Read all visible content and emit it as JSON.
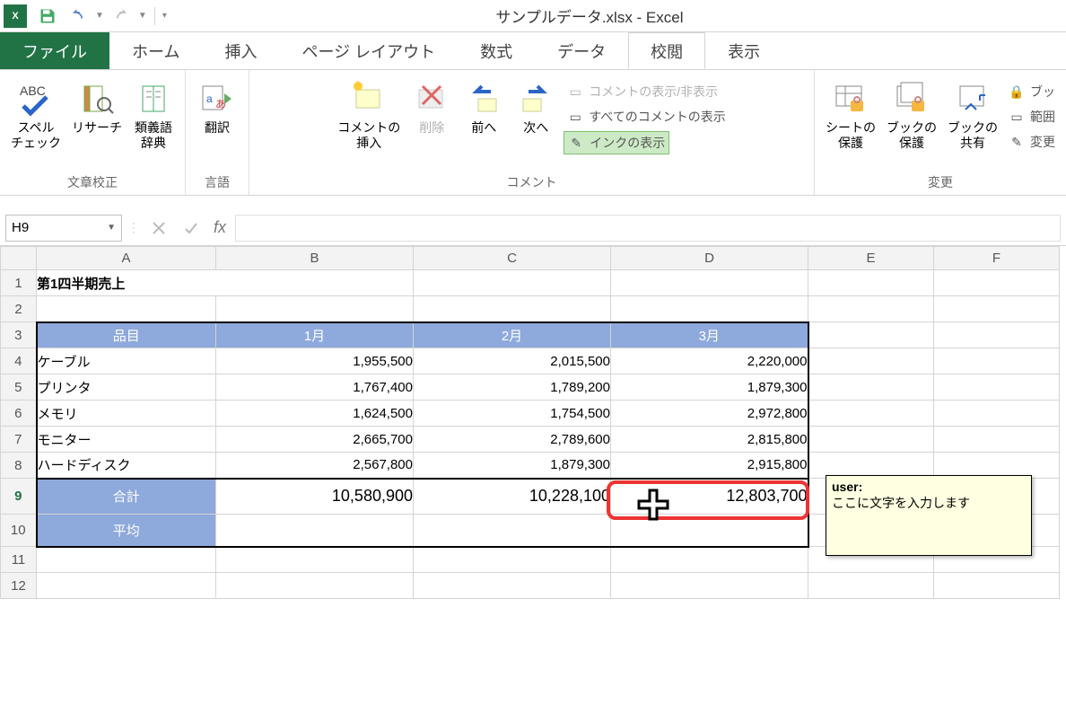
{
  "title": "サンプルデータ.xlsx - Excel",
  "qat": {
    "app_abbrev": "x",
    "save": "保存",
    "undo": "元に戻す",
    "redo": "やり直し"
  },
  "tabs": {
    "file": "ファイル",
    "home": "ホーム",
    "insert": "挿入",
    "pagelayout": "ページ レイアウト",
    "formulas": "数式",
    "data": "データ",
    "review": "校閲",
    "view": "表示"
  },
  "ribbon": {
    "proofing": {
      "label": "文章校正",
      "spell": "スペル\nチェック",
      "research": "リサーチ",
      "thesaurus": "類義語\n辞典"
    },
    "language": {
      "label": "言語",
      "translate": "翻訳"
    },
    "comments": {
      "label": "コメント",
      "new": "コメントの\n挿入",
      "delete": "削除",
      "prev": "前へ",
      "next": "次へ",
      "toggle": "コメントの表示/非表示",
      "showall": "すべてのコメントの表示",
      "ink": "インクの表示"
    },
    "changes": {
      "label": "変更",
      "protect_sheet": "シートの\n保護",
      "protect_book": "ブックの\n保護",
      "share_book": "ブックの\n共有",
      "protect_share": "ブッ",
      "range": "範囲",
      "track": "変更"
    }
  },
  "namebox": "H9",
  "formula": "",
  "cols": [
    "A",
    "B",
    "C",
    "D",
    "E",
    "F"
  ],
  "sheet_title": "第1四半期売上",
  "headers": {
    "item": "品目",
    "m1": "1月",
    "m2": "2月",
    "m3": "3月"
  },
  "rows": [
    {
      "item": "ケーブル",
      "m1": "1,955,500",
      "m2": "2,015,500",
      "m3": "2,220,000"
    },
    {
      "item": "プリンタ",
      "m1": "1,767,400",
      "m2": "1,789,200",
      "m3": "1,879,300"
    },
    {
      "item": "メモリ",
      "m1": "1,624,500",
      "m2": "1,754,500",
      "m3": "2,972,800"
    },
    {
      "item": "モニター",
      "m1": "2,665,700",
      "m2": "2,789,600",
      "m3": "2,815,800"
    },
    {
      "item": "ハードディスク",
      "m1": "2,567,800",
      "m2": "1,879,300",
      "m3": "2,915,800"
    }
  ],
  "totals": {
    "label": "合計",
    "m1": "10,580,900",
    "m2": "10,228,100",
    "m3": "12,803,700"
  },
  "avg": {
    "label": "平均"
  },
  "comment": {
    "author": "user:",
    "body": "ここに文字を入力します"
  }
}
